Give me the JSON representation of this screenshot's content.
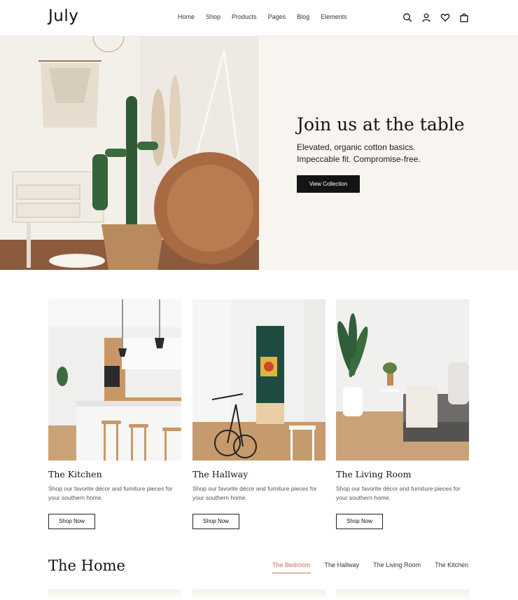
{
  "header": {
    "logo": "July",
    "nav": [
      "Home",
      "Shop",
      "Products",
      "Pages",
      "Blog",
      "Elements"
    ],
    "icons": [
      "search-icon",
      "user-icon",
      "heart-icon",
      "bag-icon"
    ]
  },
  "hero": {
    "title": "Join us at the table",
    "subtitle_line1": "Elevated, organic cotton basics.",
    "subtitle_line2": "Impeccable fit. Compromise-free.",
    "button": "View Collection"
  },
  "cards": [
    {
      "title": "The Kitchen",
      "desc": "Shop our favorite décor and furniture pieces for your southern home.",
      "button": "Shop Now"
    },
    {
      "title": "The Hallway",
      "desc": "Shop our favorite décor and furniture pieces for your southern home.",
      "button": "Shop Now"
    },
    {
      "title": "The Living Room",
      "desc": "Shop our favorite décor and furniture pieces for your southern home.",
      "button": "Shop Now"
    }
  ],
  "home": {
    "title": "The Home",
    "tabs": [
      "The Bedroom",
      "The Hallway",
      "The Living Room",
      "The Kitchen"
    ],
    "active_tab": "The Bedroom"
  },
  "colors": {
    "accent": "#c4774b",
    "dark": "#141414",
    "panel": "#f8f4ef"
  }
}
